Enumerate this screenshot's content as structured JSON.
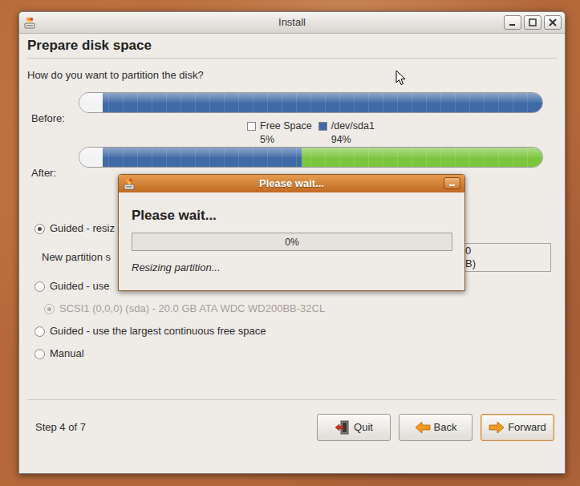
{
  "window": {
    "title": "Install"
  },
  "page": {
    "heading": "Prepare disk space",
    "question": "How do you want to partition the disk?"
  },
  "partition_chart": {
    "before": {
      "label": "Before:",
      "segments": [
        {
          "level": 0.05,
          "color": "#f3f3f3"
        },
        {
          "level": 0.95,
          "color": "#3f6aa6"
        }
      ]
    },
    "legend": [
      {
        "label": "Free Space",
        "percent": "5%",
        "color": "#ffffff"
      },
      {
        "label": "/dev/sda1",
        "percent": "94%",
        "color": "#3f6aa6"
      }
    ],
    "after": {
      "label": "After:",
      "segments": [
        {
          "level": 0.05,
          "color": "#f3f3f3"
        },
        {
          "level": 0.43,
          "color": "#3f6aa6"
        },
        {
          "level": 0.52,
          "color": "#7cc63f"
        }
      ]
    }
  },
  "options": [
    {
      "kind": "radio",
      "label": "Guided - resiz",
      "selected": true,
      "disabled": false
    },
    {
      "kind": "size-field",
      "label": "New partition s",
      "field_lines": [
        "0",
        "B)"
      ]
    },
    {
      "kind": "radio",
      "label": "Guided - use",
      "selected": false,
      "disabled": false
    },
    {
      "kind": "sub-radio",
      "label": "SCSI1 (0,0,0) (sda) - 20.0 GB ATA WDC WD200BB-32CL",
      "selected": true,
      "disabled": true
    },
    {
      "kind": "radio",
      "label": "Guided - use the largest continuous free space",
      "selected": false,
      "disabled": false
    },
    {
      "kind": "radio",
      "label": "Manual",
      "selected": false,
      "disabled": false
    }
  ],
  "step": "Step 4 of 7",
  "buttons": [
    {
      "label": "Quit",
      "kind": "quit",
      "default": false
    },
    {
      "label": "Back",
      "kind": "back",
      "default": false
    },
    {
      "label": "Forward",
      "kind": "forward",
      "default": true
    }
  ],
  "dialog": {
    "title": "Please wait...",
    "heading": "Please wait...",
    "progress": {
      "level": 0,
      "text": "0%"
    },
    "status": "Resizing partition..."
  }
}
